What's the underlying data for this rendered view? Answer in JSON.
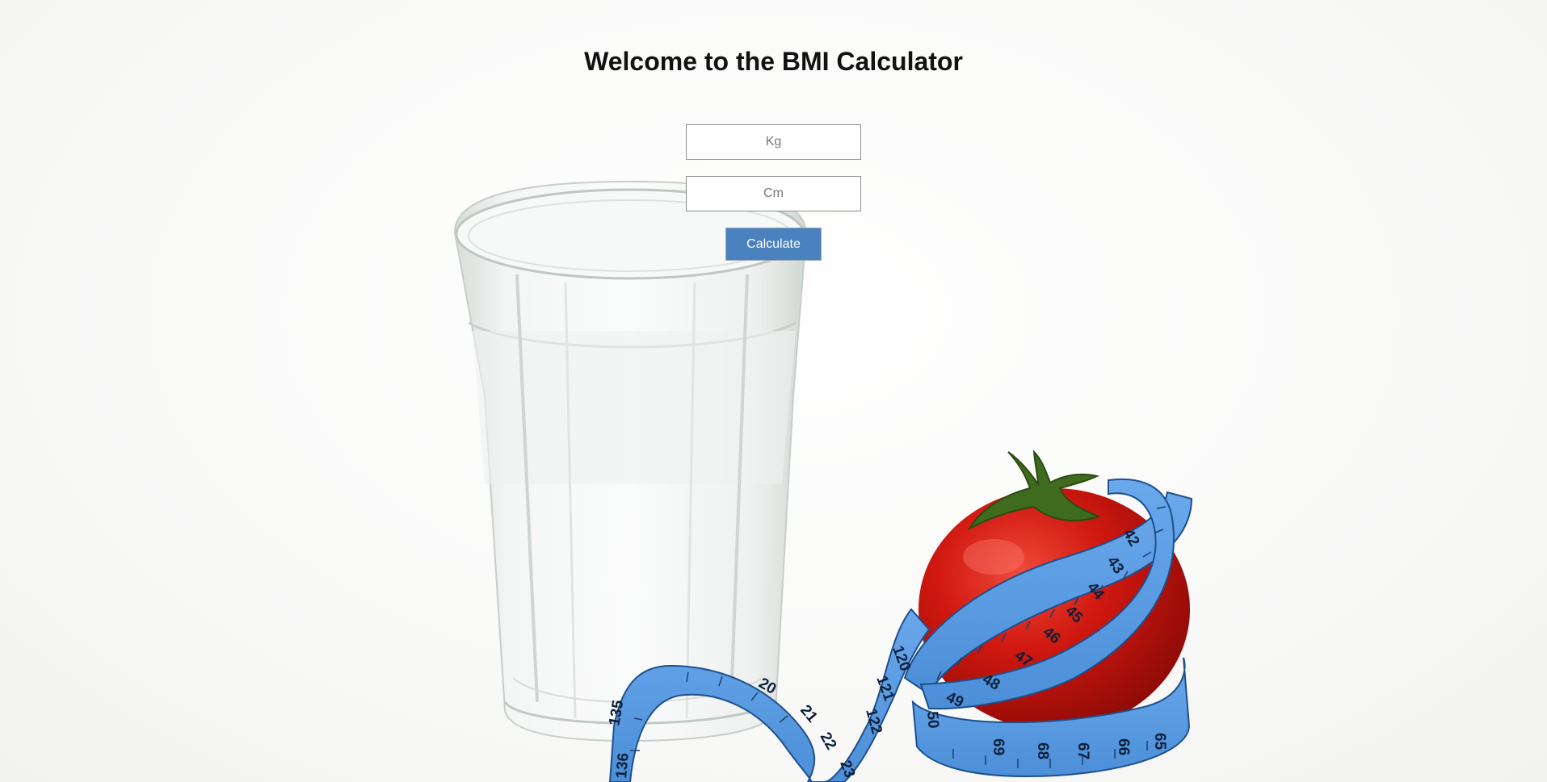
{
  "page": {
    "title": "Welcome to the BMI Calculator"
  },
  "form": {
    "weight_placeholder": "Kg",
    "height_placeholder": "Cm",
    "weight_value": "",
    "height_value": "",
    "calculate_label": "Calculate"
  },
  "background": {
    "tape_numbers": [
      "20",
      "21",
      "22",
      "23",
      "120",
      "121",
      "122",
      "42",
      "43",
      "44",
      "45",
      "46",
      "47",
      "48",
      "49",
      "50",
      "65",
      "66",
      "67",
      "68",
      "69",
      "135",
      "136"
    ]
  },
  "colors": {
    "button_bg": "#4a81bf",
    "tape_blue": "#5b9be0",
    "tomato_red": "#c8140f"
  }
}
